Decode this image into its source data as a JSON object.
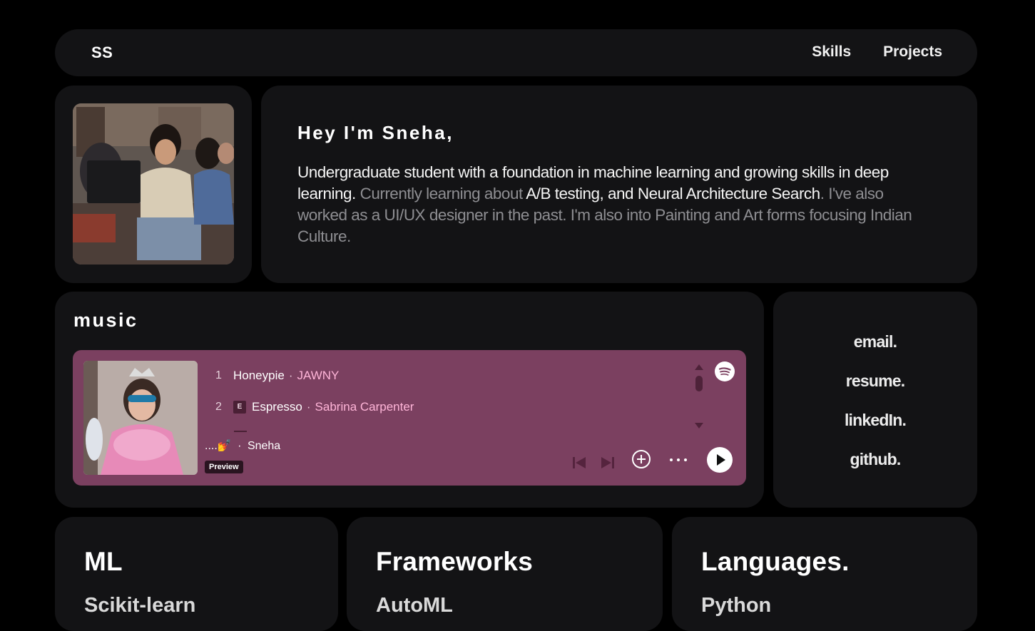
{
  "nav": {
    "logo": "SS",
    "links": [
      "Skills",
      "Projects"
    ]
  },
  "intro": {
    "heading": "Hey I'm Sneha,",
    "bio_part1": "Undergraduate student with a foundation in machine learning and growing skills in deep learning.",
    "bio_part2": " Currently learning about ",
    "bio_part3": "A/B testing, and Neural Architecture Search",
    "bio_part4": ". I've also worked as a UI/UX designer in the past. I'm also into Painting and Art forms focusing Indian Culture."
  },
  "music": {
    "heading": "music",
    "tracks": [
      {
        "num": "1",
        "title": "Honeypie",
        "artist": "JAWNY",
        "explicit": false
      },
      {
        "num": "2",
        "title": "Espresso",
        "artist": "Sabrina Carpenter",
        "explicit": true,
        "explicit_label": "E"
      }
    ],
    "separator": "·",
    "playlist_name": "....💅",
    "playlist_owner": "Sneha",
    "preview_label": "Preview",
    "player_color": "#7b4060"
  },
  "contact": {
    "links": [
      "email.",
      "resume.",
      "linkedIn.",
      "github."
    ]
  },
  "skills": [
    {
      "title": "ML",
      "first_item": "Scikit-learn"
    },
    {
      "title": "Frameworks",
      "first_item": "AutoML"
    },
    {
      "title": "Languages.",
      "first_item": "Python"
    }
  ]
}
